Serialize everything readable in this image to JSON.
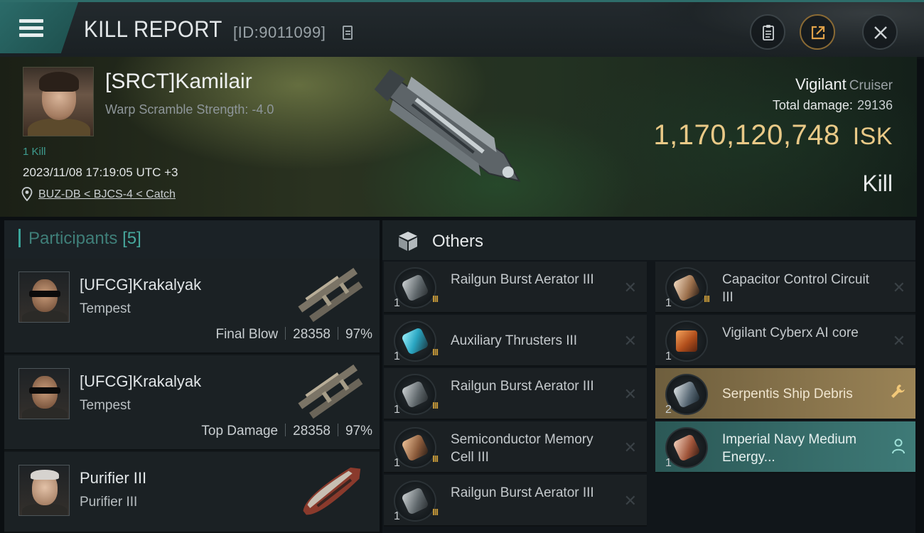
{
  "header": {
    "title": "KILL REPORT",
    "id_text": "[ID:9011099]"
  },
  "victim": {
    "name": "[SRCT]Kamilair",
    "warp_scramble": "Warp Scramble Strength: -4.0",
    "kills": "1 Kill",
    "datetime": "2023/11/08 17:19:05 UTC +3",
    "location": "BUZ-DB < BJCS-4 < Catch",
    "ship_name": "Vigilant",
    "ship_class": "Cruiser",
    "total_damage_label": "Total damage:",
    "total_damage": "29136",
    "isk_value": "1,170,120,748",
    "isk_unit": "ISK",
    "result": "Kill"
  },
  "participants": {
    "label": "Participants",
    "count": "[5]",
    "rows": [
      {
        "name": "[UFCG]Krakalyak",
        "ship": "Tempest",
        "tag": "Final Blow",
        "damage": "28358",
        "percent": "97%"
      },
      {
        "name": "[UFCG]Krakalyak",
        "ship": "Tempest",
        "tag": "Top Damage",
        "damage": "28358",
        "percent": "97%"
      },
      {
        "name": "Purifier III",
        "ship": "Purifier III"
      }
    ]
  },
  "others": {
    "label": "Others",
    "items": [
      {
        "name": "Railgun Burst Aerator III",
        "qty": "1",
        "tier": "III",
        "col": 1
      },
      {
        "name": "Auxiliary Thrusters III",
        "qty": "1",
        "tier": "III",
        "col": 1
      },
      {
        "name": "Railgun Burst Aerator III",
        "qty": "1",
        "tier": "III",
        "col": 1
      },
      {
        "name": "Semiconductor Memory Cell III",
        "qty": "1",
        "tier": "III",
        "col": 1
      },
      {
        "name": "Railgun Burst Aerator III",
        "qty": "1",
        "tier": "III",
        "col": 1
      },
      {
        "name": "Capacitor Control Circuit III",
        "qty": "1",
        "tier": "III",
        "col": 2
      },
      {
        "name": "Vigilant Cyberx AI core",
        "qty": "1",
        "col": 2
      },
      {
        "name": "Serpentis Ship Debris",
        "qty": "2",
        "col": 2,
        "state": "wrench"
      },
      {
        "name": "Imperial Navy Medium Energy...",
        "qty": "1",
        "col": 2,
        "state": "person"
      }
    ]
  },
  "colors": {
    "accent_teal": "#3aa59a",
    "isk_gold": "#e9c987",
    "highlight_gold": "#9a8356",
    "highlight_teal": "#3e7a77"
  }
}
